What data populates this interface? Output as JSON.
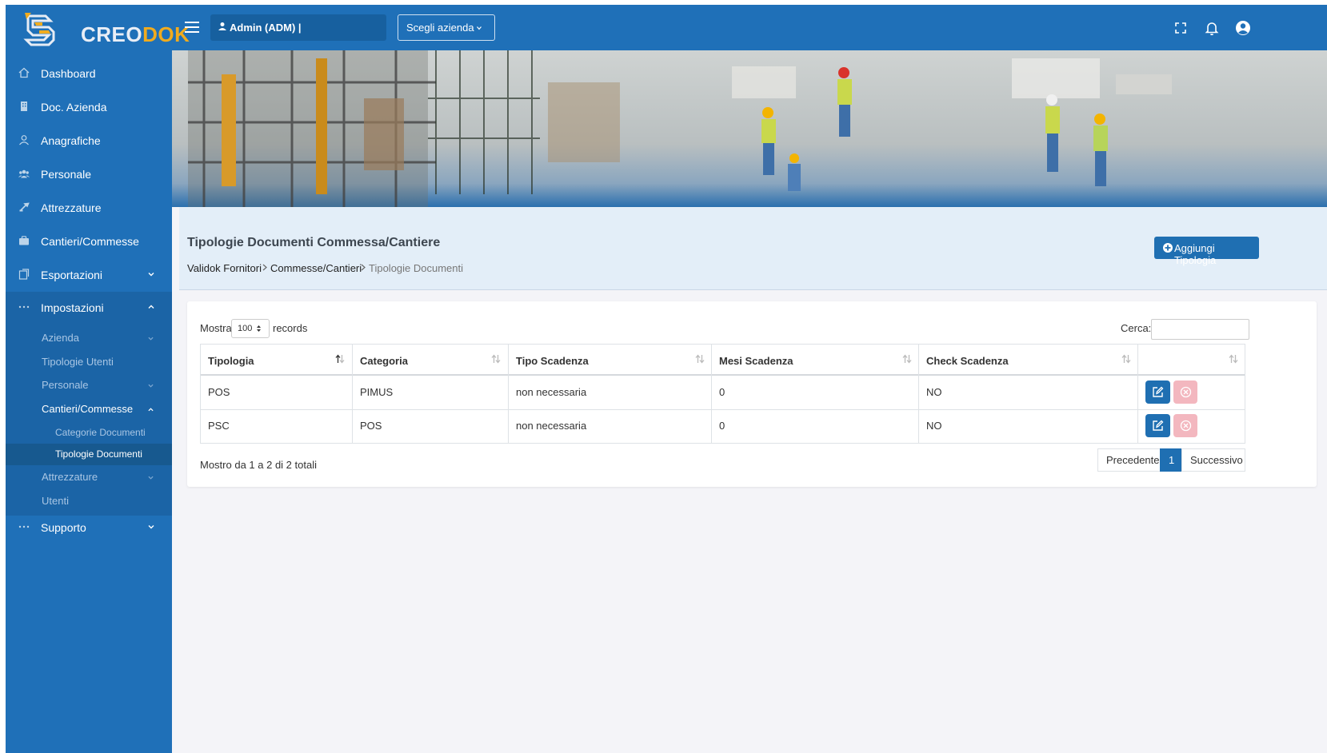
{
  "header": {
    "logo_part1": "CREO",
    "logo_part2": "DOK",
    "user_label": "Admin (ADM) |",
    "company_button": "Scegli azienda",
    "icons": [
      "menu-icon",
      "user-icon",
      "fullscreen-icon",
      "bell-icon",
      "account-icon"
    ]
  },
  "sidebar": {
    "items": [
      {
        "label": "Dashboard",
        "icon": "home-icon"
      },
      {
        "label": "Doc. Azienda",
        "icon": "building-icon"
      },
      {
        "label": "Anagrafiche",
        "icon": "person-icon"
      },
      {
        "label": "Personale",
        "icon": "people-icon"
      },
      {
        "label": "Attrezzature",
        "icon": "tool-icon"
      },
      {
        "label": "Cantieri/Commesse",
        "icon": "briefcase-icon"
      },
      {
        "label": "Esportazioni",
        "icon": "export-icon"
      },
      {
        "label": "Impostazioni",
        "icon": "dots-icon"
      },
      {
        "label": "Supporto",
        "icon": "dots-icon"
      }
    ],
    "settings_sub": [
      {
        "label": "Azienda"
      },
      {
        "label": "Tipologie Utenti"
      },
      {
        "label": "Personale"
      },
      {
        "label": "Cantieri/Commesse"
      },
      {
        "label": "Attrezzature"
      },
      {
        "label": "Utenti"
      }
    ],
    "cantieri_sub": [
      {
        "label": "Categorie Documenti"
      },
      {
        "label": "Tipologie Documenti"
      }
    ]
  },
  "page": {
    "title": "Tipologie Documenti Commessa/Cantiere",
    "breadcrumb": [
      "Validok Fornitori",
      "Commesse/Cantieri",
      "Tipologie Documenti"
    ],
    "add_button": "Aggiungi Tipologia"
  },
  "table": {
    "show_label": "Mostra",
    "page_size": "100",
    "records_label": "records",
    "search_label": "Cerca:",
    "search_value": "",
    "columns": [
      "Tipologia",
      "Categoria",
      "Tipo Scadenza",
      "Mesi Scadenza",
      "Check Scadenza",
      ""
    ],
    "rows": [
      [
        "POS",
        "PIMUS",
        "non necessaria",
        "0",
        "NO"
      ],
      [
        "PSC",
        "POS",
        "non necessaria",
        "0",
        "NO"
      ]
    ],
    "info": "Mostro da 1 a 2 di 2 totali",
    "pagination": {
      "prev": "Precedente",
      "current": "1",
      "next": "Successivo"
    }
  },
  "colors": {
    "primary": "#1f70b8",
    "logo_accent": "#f0ab1e",
    "header_panel": "#e3eef8",
    "delete_button": "#f3b7bf"
  }
}
